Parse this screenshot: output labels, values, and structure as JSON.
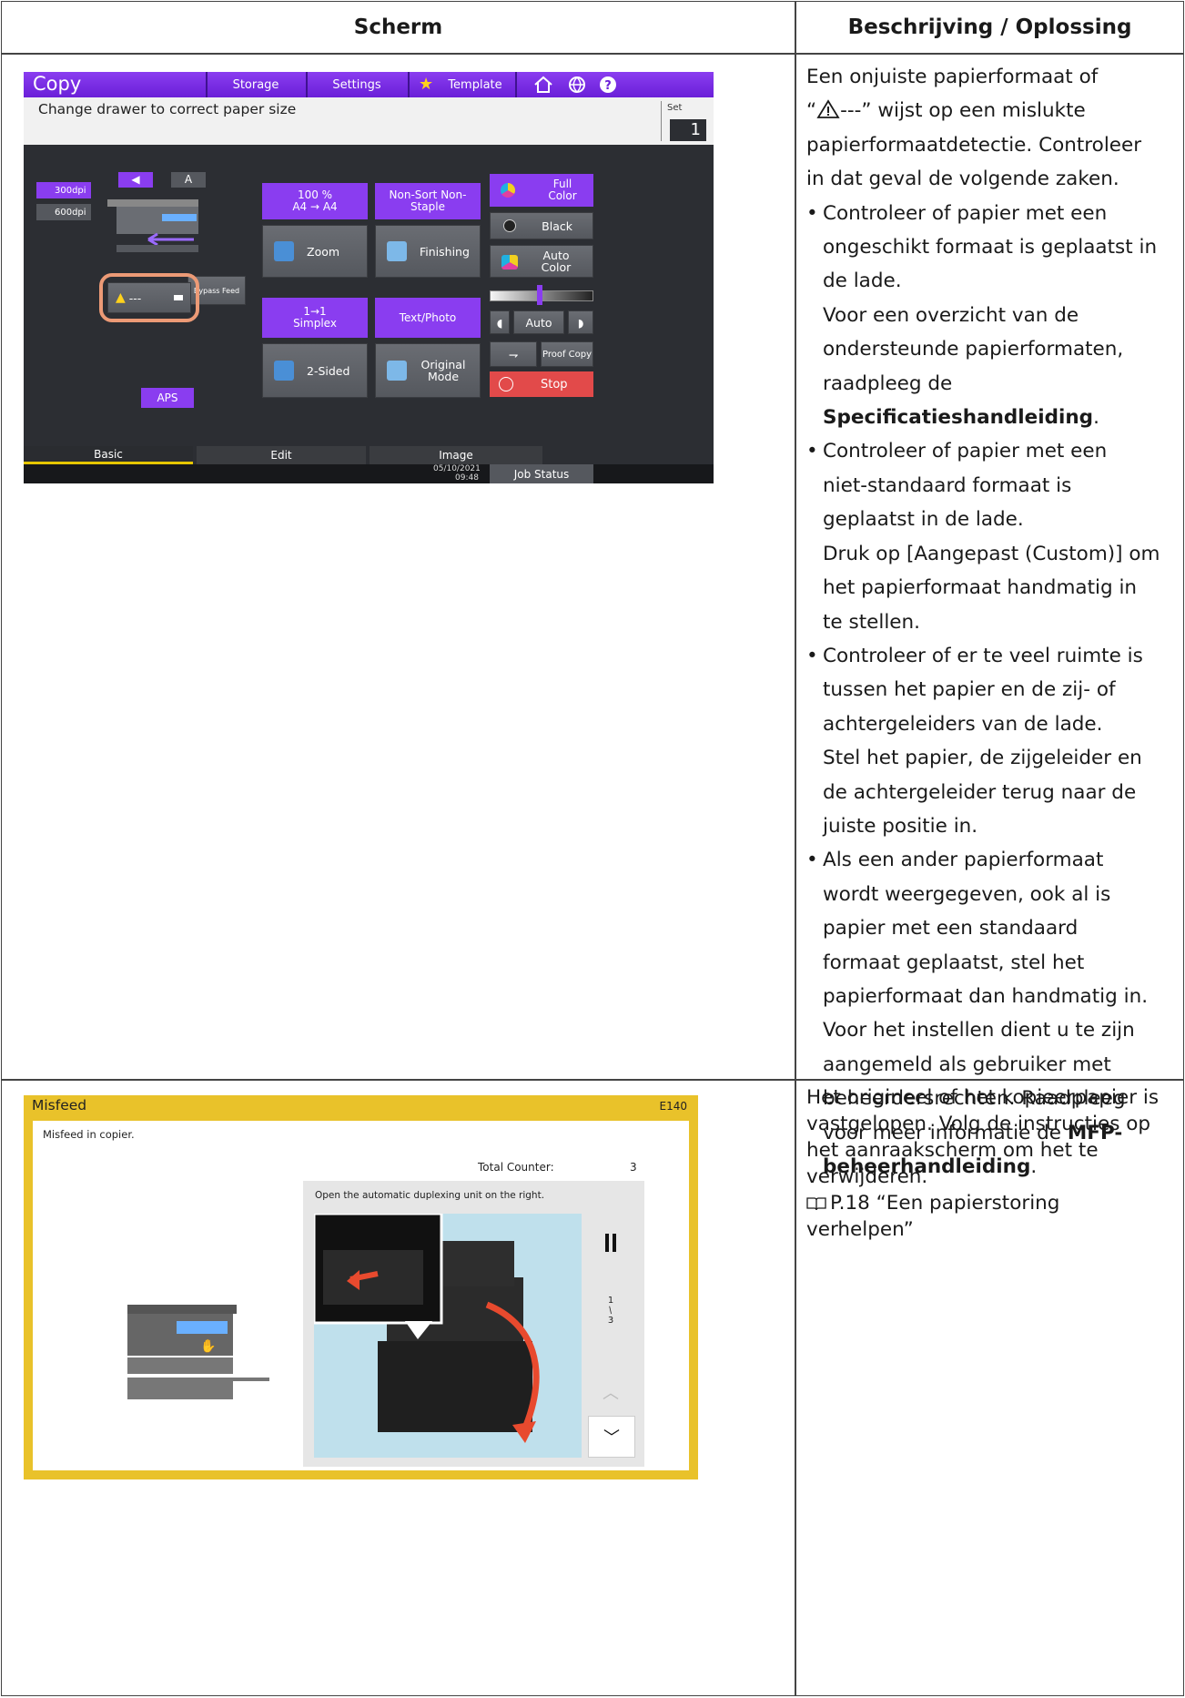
{
  "table": {
    "header_screen": "Scherm",
    "header_description": "Beschrijving / Oplossing"
  },
  "row1": {
    "copy_screen": {
      "app_title": "Copy",
      "tabs": [
        "Storage",
        "Settings",
        "Template"
      ],
      "message": "Change drawer to correct paper size",
      "set_label": "Set",
      "set_value": "1",
      "resolution_300": "300dpi",
      "resolution_600": "600dpi",
      "bypass_label": "Bypass Feed",
      "drawer_status": "---",
      "zoom_top": "100 %",
      "zoom_sizes": "A4 → A4",
      "zoom_label": "Zoom",
      "finishing_top": "Non-Sort Non-Staple",
      "finishing_label": "Finishing",
      "sided_top": "1→1 Simplex",
      "sided_label": "2-Sided",
      "original_top": "Text/Photo",
      "original_label": "Original Mode",
      "aps_label": "APS",
      "color_full": "Full Color",
      "color_black": "Black",
      "color_auto": "Auto Color",
      "density_auto": "Auto",
      "proof_copy": "Proof Copy",
      "stop": "Stop",
      "bottom_tabs": [
        "Basic",
        "Edit",
        "Image"
      ],
      "date": "05/10/2021",
      "time": "09:48",
      "job_status": "Job Status",
      "accent_color": "#8a3df0"
    },
    "description": {
      "intro_a": "Een onjuiste papierformaat of",
      "intro_b_quote_open": "“",
      "intro_b_rest": "---” wijst op een mislukte",
      "intro_c": "papierformaatdetectie. Controleer",
      "intro_d": "in dat geval de volgende zaken.",
      "b1_l1": "Controleer of papier met een",
      "b1_l2": "ongeschikt formaat is geplaatst in",
      "b1_l3": "de lade.",
      "b1_s1": "Voor een overzicht van de",
      "b1_s2": "ondersteunde papierformaten,",
      "b1_s3": "raadpleeg de",
      "b1_s4_bold": "Specificatieshandleiding",
      "b1_s4_end": ".",
      "b2_l1": "Controleer of papier met een",
      "b2_l2": "niet-standaard formaat is",
      "b2_l3": "geplaatst in de lade.",
      "b2_s1": "Druk op [Aangepast (Custom)] om",
      "b2_s2": "het papierformaat handmatig in",
      "b2_s3": "te stellen.",
      "b3_l1": "Controleer of er te veel ruimte is",
      "b3_l2": "tussen het papier en de zij- of",
      "b3_l3": "achtergeleiders van de lade.",
      "b3_s1": "Stel het papier, de zijgeleider en",
      "b3_s2": "de achtergeleider terug naar de",
      "b3_s3": "juiste positie in.",
      "b4_l1": "Als een ander papierformaat",
      "b4_l2": "wordt weergegeven, ook al is",
      "b4_l3": "papier met een standaard",
      "b4_l4": "formaat geplaatst, stel het",
      "b4_l5": "papierformaat dan handmatig in.",
      "b4_l6": "Voor het instellen dient u te zijn",
      "b4_l7": "aangemeld als gebruiker met",
      "b4_l8": "beheerdersrechten. Raadpleeg",
      "b4_l9_a": "voor meer informatie de ",
      "b4_l9_bold": "MFP-",
      "b4_l10_bold": "beheerhandleiding",
      "b4_l10_end": "."
    }
  },
  "row2": {
    "misfeed_screen": {
      "title": "Misfeed",
      "code": "E140",
      "message": "Misfeed in copier.",
      "counter_label": "Total Counter:",
      "counter_value": "3",
      "instruction": "Open the automatic duplexing unit on the right.",
      "step_current": "1",
      "step_total": "3",
      "frame_color": "#e9c22a"
    },
    "description": {
      "l1": "Het origineel of het kopieerpapier is",
      "l2": "vastgelopen. Volg de instructies op",
      "l3": "het aanraakscherm om het te",
      "l4": "verwijderen.",
      "ref": "P.18 “Een papierstoring",
      "ref2": "verhelpen”"
    }
  }
}
